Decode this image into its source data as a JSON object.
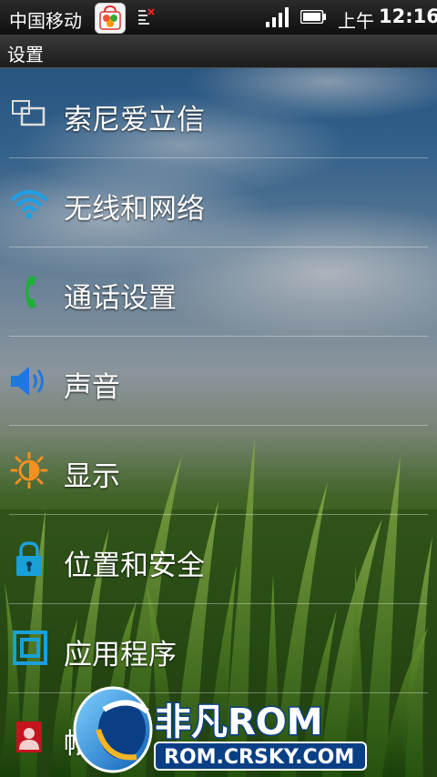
{
  "status_bar": {
    "carrier": "中国移动",
    "ampm": "上午",
    "time": "12:16"
  },
  "title_bar": {
    "title": "设置"
  },
  "settings": {
    "items": [
      {
        "label": "索尼爱立信",
        "icon": "sony-ericsson-icon"
      },
      {
        "label": "无线和网络",
        "icon": "wifi-icon"
      },
      {
        "label": "通话设置",
        "icon": "phone-icon"
      },
      {
        "label": "声音",
        "icon": "speaker-icon"
      },
      {
        "label": "显示",
        "icon": "brightness-icon"
      },
      {
        "label": "位置和安全",
        "icon": "lock-icon"
      },
      {
        "label": "应用程序",
        "icon": "applications-icon"
      },
      {
        "label": "帐",
        "icon": "accounts-icon"
      }
    ]
  },
  "watermark": {
    "brand": "非凡ROM",
    "url": "ROM.CRSKY.COM"
  },
  "colors": {
    "wifi_blue": "#1ea0e6",
    "phone_green": "#1fae3a",
    "speaker_blue": "#1e78e0",
    "sun_orange": "#f39021",
    "lock_blue": "#1aa0d8",
    "accounts_red": "#c4141e",
    "watermark_green": "#9be33a"
  }
}
